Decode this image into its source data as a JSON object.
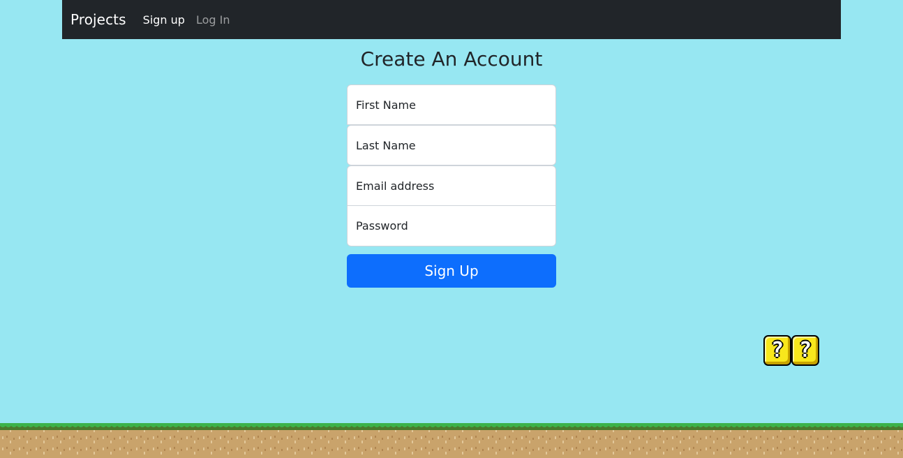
{
  "nav": {
    "brand": "Projects",
    "links": [
      {
        "label": "Sign up",
        "active": true
      },
      {
        "label": "Log In",
        "active": false
      }
    ]
  },
  "page": {
    "title": "Create An Account"
  },
  "form": {
    "first_name_placeholder": "First Name",
    "last_name_placeholder": "Last Name",
    "email_placeholder": "Email address",
    "password_placeholder": "Password",
    "submit_label": "Sign Up"
  },
  "decorations": {
    "question_block_icons": [
      "question-block-icon",
      "question-block-icon"
    ],
    "ground": "grass-dirt-ground"
  },
  "colors": {
    "sky": "#97e7f2",
    "navbar": "#212529",
    "primary_button": "#0d6efd",
    "grass": "#3bb34a",
    "dirt": "#c9a36b"
  }
}
